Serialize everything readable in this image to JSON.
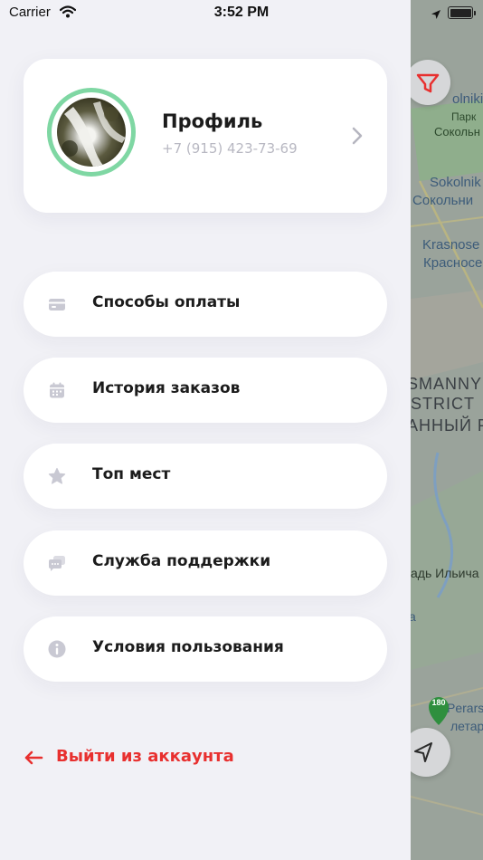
{
  "status_bar": {
    "carrier": "Carrier",
    "time": "3:52 PM"
  },
  "profile": {
    "name": "Профиль",
    "phone": "+7 (915) 423-73-69"
  },
  "menu": [
    {
      "label": "Способы оплаты",
      "icon": "credit-card-icon"
    },
    {
      "label": "История заказов",
      "icon": "calendar-icon"
    },
    {
      "label": "Топ мест",
      "icon": "star-icon"
    },
    {
      "label": "Служба поддержки",
      "icon": "chat-icon"
    },
    {
      "label": "Условия пользования",
      "icon": "info-icon"
    }
  ],
  "logout": {
    "label": "Выйти из аккаунта"
  },
  "map": {
    "labels": [
      "olniki",
      "Парк",
      "Сокольн",
      "Sokolnik",
      "Сокольни",
      "Krasnose",
      "Красносе",
      "SMANNY",
      "STRICT",
      "АННЫЙ Р",
      "адь Ильича",
      "а",
      "Perarska",
      "летар"
    ],
    "badge": "180"
  },
  "colors": {
    "accent": "#e8302f",
    "avatar_ring": "#7fd7a3",
    "icon": "#c9c9d3"
  }
}
